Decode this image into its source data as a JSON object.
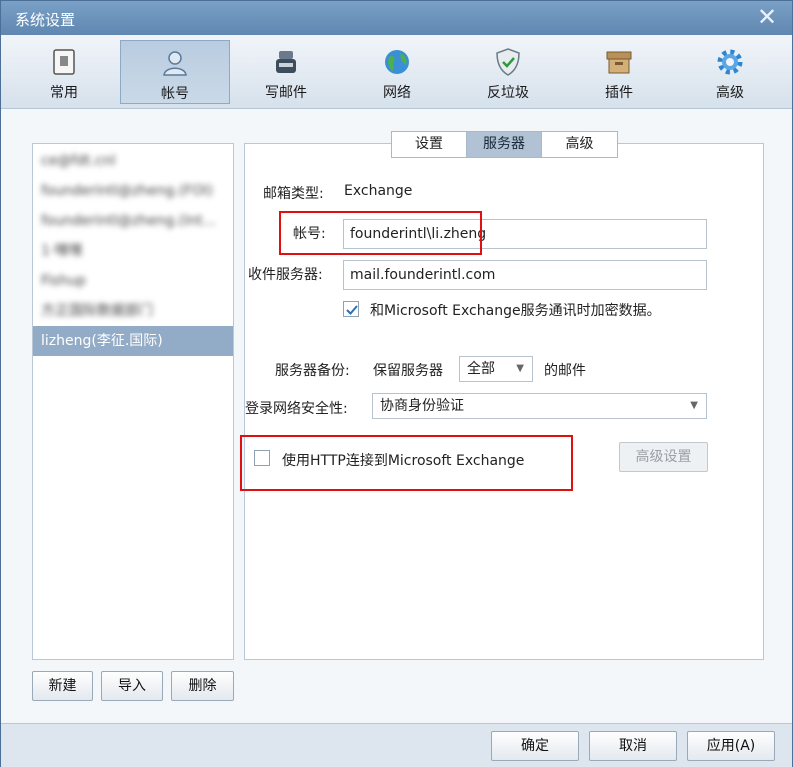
{
  "window": {
    "title": "系统设置"
  },
  "toolbar": {
    "items": [
      {
        "label": "常用",
        "icon": "phone-icon"
      },
      {
        "label": "帐号",
        "icon": "user-icon",
        "active": true
      },
      {
        "label": "写邮件",
        "icon": "inkwell-icon"
      },
      {
        "label": "网络",
        "icon": "globe-icon"
      },
      {
        "label": "反垃圾",
        "icon": "shield-icon"
      },
      {
        "label": "插件",
        "icon": "box-icon"
      },
      {
        "label": "高级",
        "icon": "gear-icon"
      }
    ]
  },
  "accounts": {
    "items": [
      {
        "label": "ce@fdt.cnl"
      },
      {
        "label": "founderintl@zheng.(FOI)"
      },
      {
        "label": "founderintl@zheng.(Int..."
      },
      {
        "label": "1·嘿嘿"
      },
      {
        "label": "Fishup"
      },
      {
        "label": "方正国际数据部门"
      },
      {
        "label": "lizheng(李征.国际)"
      }
    ],
    "selected_index": 6
  },
  "account_buttons": {
    "new": "新建",
    "import": "导入",
    "delete": "删除"
  },
  "tabs": {
    "settings": "设置",
    "server": "服务器",
    "advanced": "高级",
    "active": "server"
  },
  "form": {
    "mailbox_type_label": "邮箱类型:",
    "mailbox_type_value": "Exchange",
    "account_label": "帐号:",
    "account_value": "founderintl\\li.zheng",
    "incoming_label": "收件服务器:",
    "incoming_value": "mail.founderintl.com",
    "encrypt_label": "和Microsoft Exchange服务通讯时加密数据。",
    "encrypt_checked": true,
    "backup_label": "服务器备份:",
    "backup_prefix": "保留服务器",
    "backup_option": "全部",
    "backup_suffix": "的邮件",
    "security_label": "登录网络安全性:",
    "security_value": "协商身份验证",
    "http_label": "使用HTTP连接到Microsoft Exchange",
    "http_checked": false,
    "advanced_settings": "高级设置"
  },
  "footer": {
    "ok": "确定",
    "cancel": "取消",
    "apply": "应用(A)"
  },
  "colors": {
    "highlight": "#e01010",
    "selection": "#92abc6"
  }
}
